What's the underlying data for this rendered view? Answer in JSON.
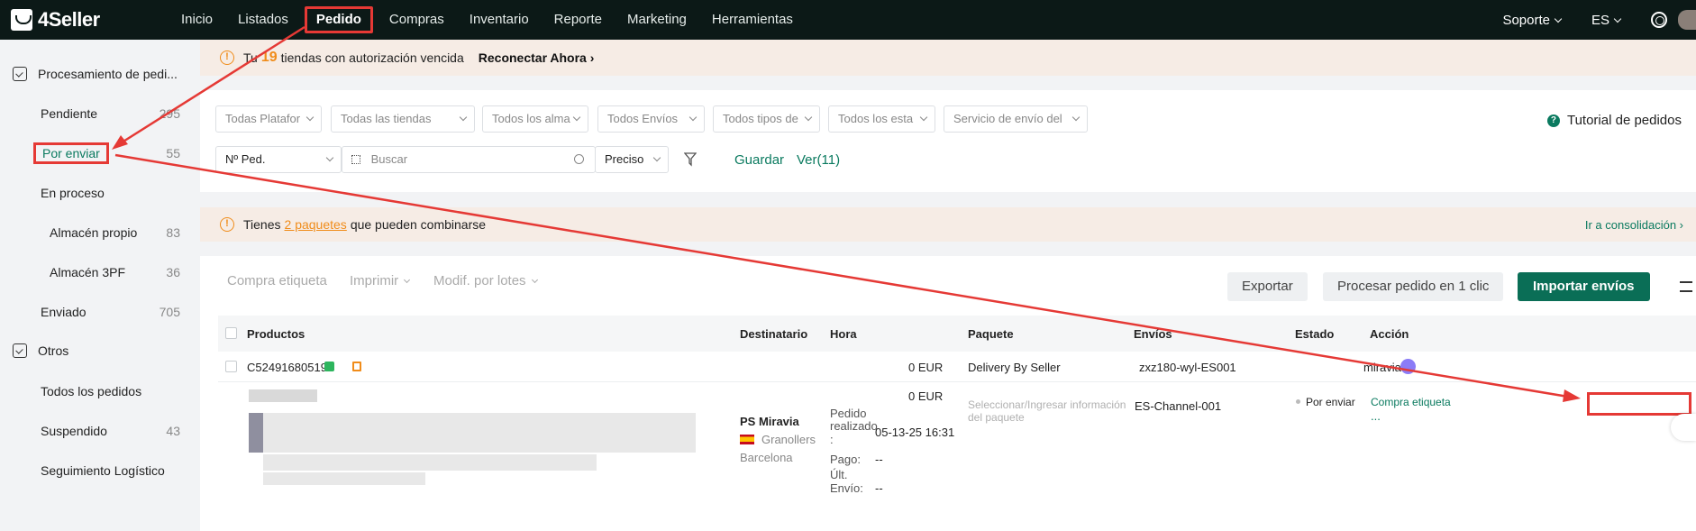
{
  "app": {
    "logo_text": "4Seller",
    "brand_color": "#0c1917",
    "accent_color": "#0a7a5f",
    "highlight_color": "#e53935"
  },
  "topnav": {
    "items": [
      "Inicio",
      "Listados",
      "Pedido",
      "Compras",
      "Inventario",
      "Reporte",
      "Marketing",
      "Herramientas"
    ],
    "active": "Pedido",
    "support": "Soporte",
    "language": "ES"
  },
  "sidebar": {
    "group1": "Procesamiento de pedi...",
    "group2": "Otros",
    "items": [
      {
        "label": "Pendiente",
        "count": "295"
      },
      {
        "label": "Por enviar",
        "count": "55"
      },
      {
        "label": "En proceso",
        "count": ""
      },
      {
        "label": "Almacén propio",
        "count": "83"
      },
      {
        "label": "Almacén 3PF",
        "count": "36"
      },
      {
        "label": "Enviado",
        "count": "705"
      },
      {
        "label": "Todos los pedidos",
        "count": ""
      },
      {
        "label": "Suspendido",
        "count": "43"
      },
      {
        "label": "Seguimiento Logístico",
        "count": ""
      }
    ]
  },
  "banner1": {
    "prefix": "Tu",
    "count": "19",
    "text": "tiendas con autorización vencida",
    "action": "Reconectar Ahora"
  },
  "filters": {
    "selects": [
      "Todas Platafor",
      "Todas las tiendas",
      "Todos los alma",
      "Todos Envíos",
      "Todos tipos de",
      "Todos los esta",
      "Servicio de envío del"
    ],
    "order_field": "Nº Ped.",
    "search_placeholder": "Buscar",
    "match_mode": "Preciso",
    "save": "Guardar",
    "view": "Ver(11)",
    "tutorial": "Tutorial de pedidos"
  },
  "banner2": {
    "prefix": "Tienes",
    "link": "2 paquetes",
    "suffix": "que pueden combinarse",
    "action": "Ir a consolidación"
  },
  "toolbar": {
    "buy_label": "Compra etiqueta",
    "print": "Imprimir",
    "batch_edit": "Modif. por lotes",
    "export": "Exportar",
    "process": "Procesar pedido en 1 clic",
    "import": "Importar envíos"
  },
  "table": {
    "columns": [
      "Productos",
      "Destinatario",
      "Hora",
      "Paquete",
      "Envíos",
      "Estado",
      "Acción"
    ],
    "order": {
      "id": "C52491680519",
      "amount": "0 EUR",
      "package": "Delivery By Seller",
      "shipping": "zxz180-wyl-ES001",
      "platform": "miravia",
      "item_amount": "0 EUR",
      "recipient_name": "PS Miravia",
      "recipient_city": "Granollers",
      "recipient_region": "Barcelona",
      "time_placed_label": "Pedido realizado",
      "time_placed_colon": ":",
      "time_placed_value": "05-13-25 16:31",
      "time_paid_label": "Pago:",
      "time_paid_value": "--",
      "time_last_label1": "Últ.",
      "time_last_label2": "Envío:",
      "time_last_value": "--",
      "package_hint1": "Seleccionar/Ingresar información",
      "package_hint2": "del paquete",
      "channel": "ES-Channel-001",
      "status": "Por enviar",
      "action": "Compra etiqueta",
      "more": "..."
    }
  }
}
